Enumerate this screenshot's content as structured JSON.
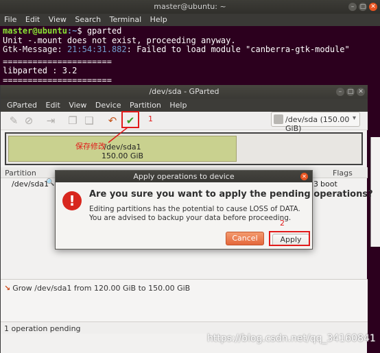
{
  "terminal": {
    "title": "master@ubuntu: ~",
    "menu": [
      "File",
      "Edit",
      "View",
      "Search",
      "Terminal",
      "Help"
    ],
    "prompt_user": "master@ubuntu",
    "prompt_path": ":~",
    "prompt_symbol": "$ ",
    "command": "gparted",
    "line2": "Unit -.mount does not exist, proceeding anyway.",
    "line3_label": "Gtk-Message",
    "line3_time": "21:54:31.882",
    "line3_text": ": Failed to load module \"canberra-gtk-module\"",
    "separator": "======================",
    "libparted": "libparted : 3.2"
  },
  "gparted": {
    "title": "/dev/sda - GParted",
    "menu": [
      "GParted",
      "Edit",
      "View",
      "Device",
      "Partition",
      "Help"
    ],
    "device_select": "/dev/sda  (150.00 GiB)",
    "disk_block_name": "/dev/sda1",
    "disk_block_size": "150.00 GiB",
    "columns": {
      "partition": "Partition",
      "flags": "Flags"
    },
    "row": {
      "partition": "/dev/sda1",
      "flags_suffix": "3",
      "flags": "boot"
    },
    "operation": "Grow /dev/sda1 from 120.00 GiB to 150.00 GiB",
    "status": "1 operation pending"
  },
  "dialog": {
    "title": "Apply operations to device",
    "heading": "Are you sure you want to apply the pending operations?",
    "message1": "Editing partitions has the potential to cause LOSS of DATA.",
    "message2": "You are advised to backup your data before proceeding.",
    "cancel_label": "Cancel",
    "apply_label": "Apply"
  },
  "annotations": {
    "step1": "1",
    "step1_note": "保存修改",
    "step2": "2"
  },
  "watermark": "https://blog.csdn.net/qq_34160841",
  "colors": {
    "terminal_bg": "#2c001e",
    "prompt_user": "#8ae234",
    "prompt_path": "#729fcf",
    "cancel_accent": "#e4683c",
    "annotation_red": "#e11a1a"
  },
  "icons": {
    "toolbar": [
      "new-icon",
      "delete-icon",
      "resize-icon",
      "copy-icon",
      "paste-icon",
      "undo-icon",
      "apply-check-icon"
    ],
    "dialog": "error-icon"
  }
}
